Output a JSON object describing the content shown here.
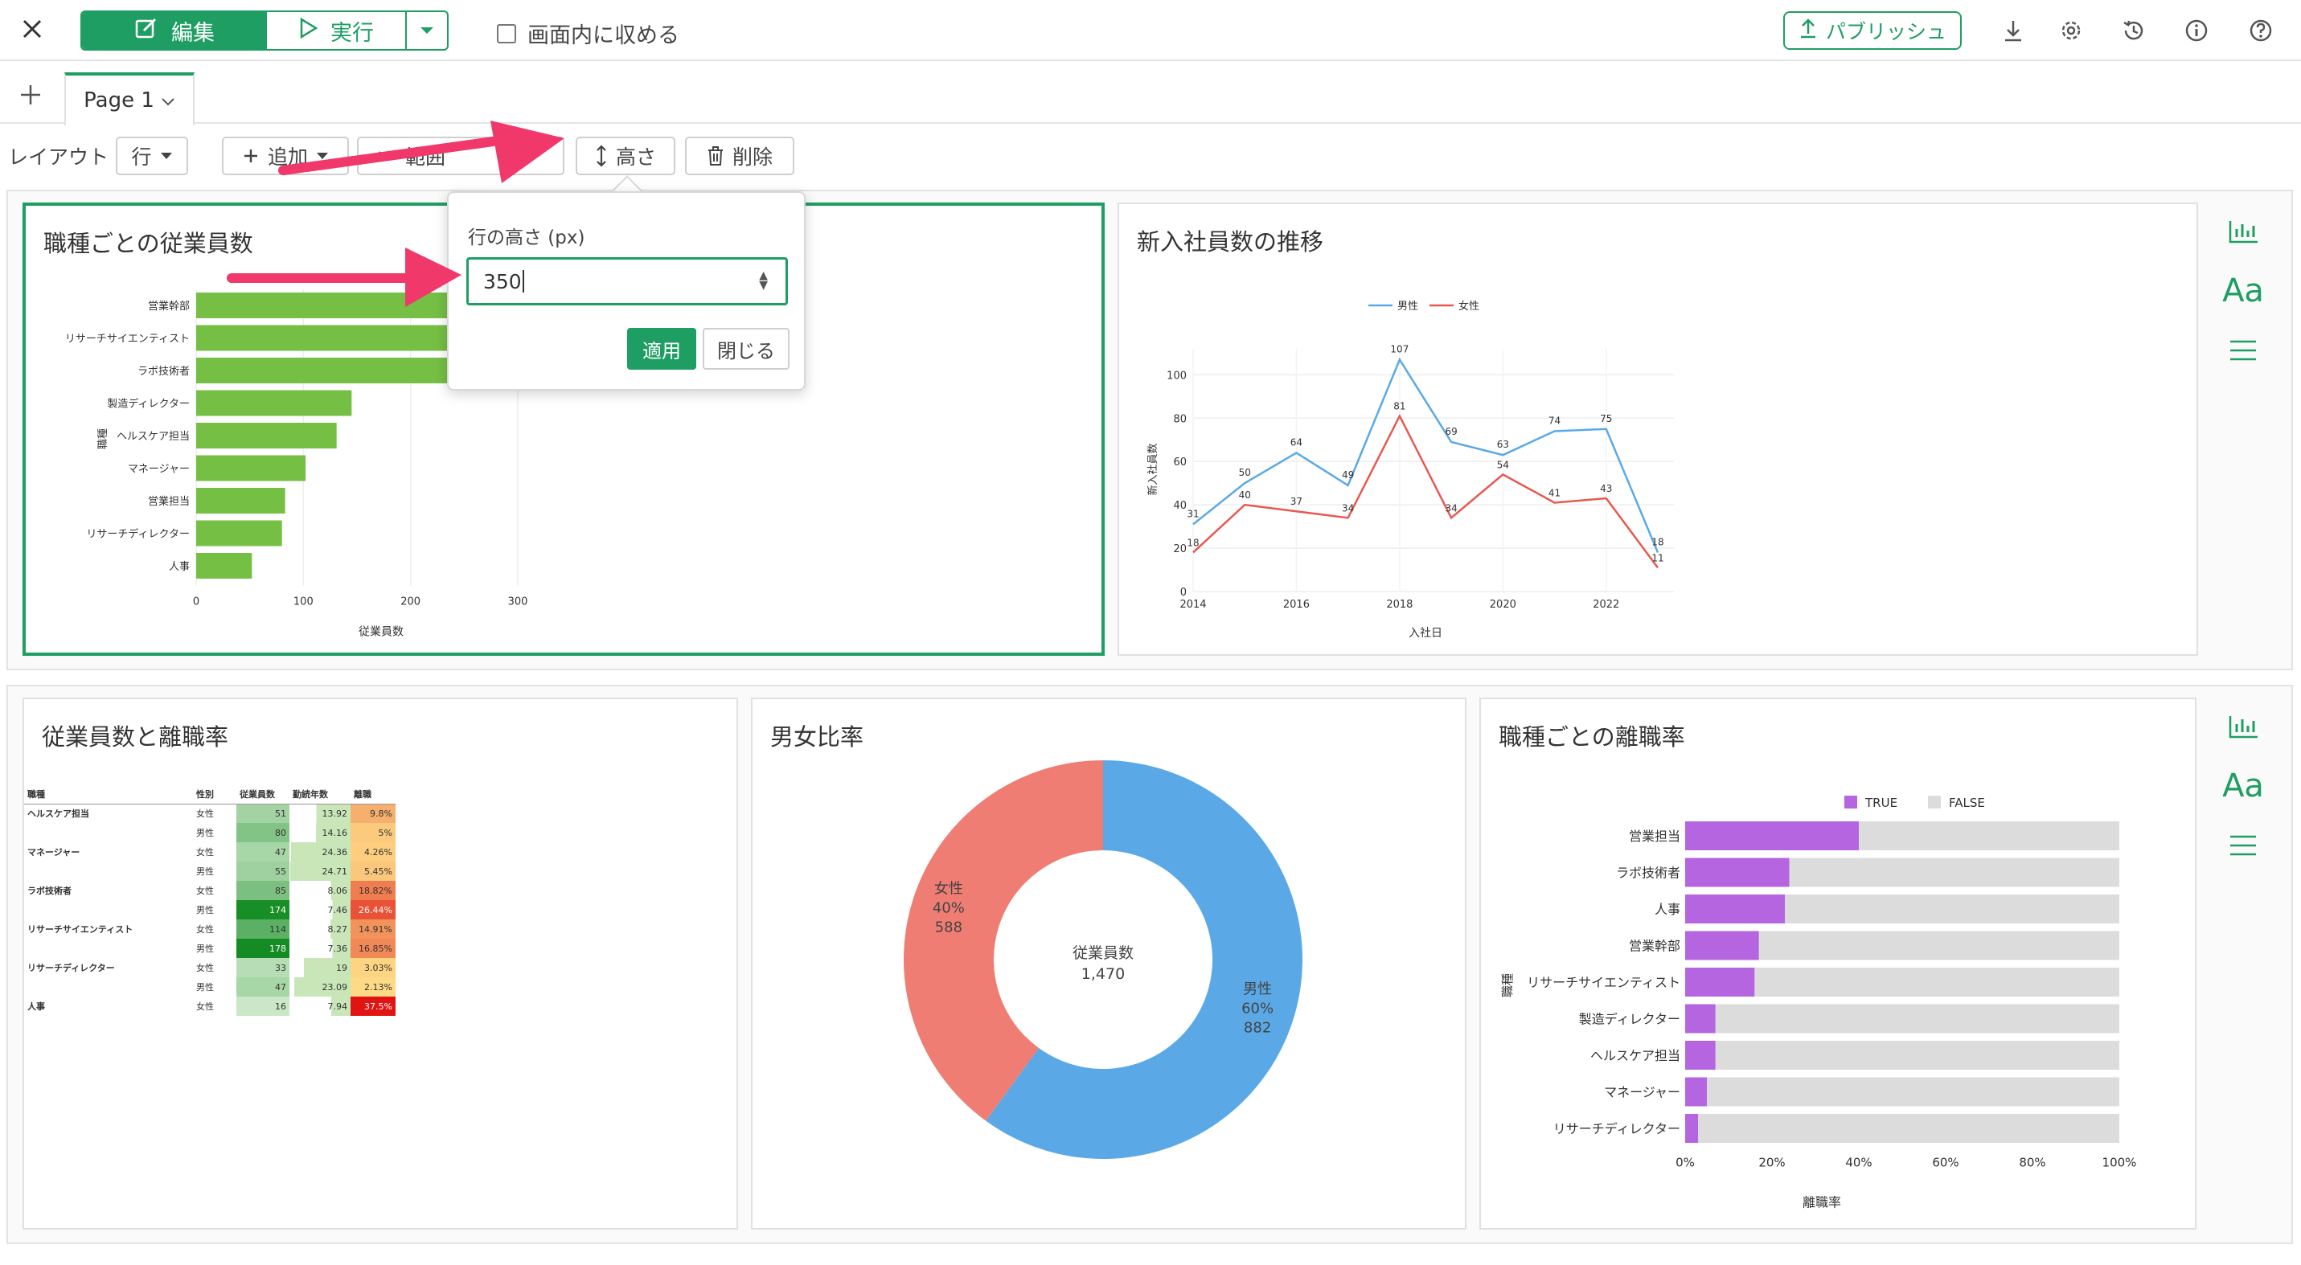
{
  "toolbar": {
    "edit_label": "編集",
    "run_label": "実行",
    "fit_label": "画面内に収める",
    "publish_label": "パブリッシュ"
  },
  "tabs": {
    "page_label": "Page 1"
  },
  "layout_bar": {
    "label": "レイアウト",
    "row_select": "行",
    "add_label": "追加",
    "range_label": "範囲",
    "height_label": "高さ",
    "delete_label": "削除"
  },
  "popup": {
    "label": "行の高さ (px)",
    "value": "350",
    "apply_label": "適用",
    "close_label": "閉じる"
  },
  "cards": {
    "c1_title": "職種ごとの従業員数",
    "c2_title": "新入社員数の推移",
    "c3_title": "従業員数と離職率",
    "c4_title": "男女比率",
    "c5_title": "職種ごとの離職率"
  },
  "icons": {
    "close": "close-icon",
    "edit": "edit-icon",
    "play": "play-icon",
    "publish": "upload-icon",
    "download": "download-icon",
    "settings": "gear-icon",
    "history": "history-icon",
    "info": "info-icon",
    "help": "help-icon",
    "chart": "bar-chart-icon",
    "text": "text-icon",
    "menu": "menu-icon"
  },
  "colors": {
    "accent": "#1e9e63",
    "bar_green": "#74bf44",
    "male": "#5aa9e6",
    "female": "#e8584f",
    "true_purple": "#b565e0",
    "false_gray": "#dcdcdc",
    "arrow": "#f0386b"
  },
  "chart_data": [
    {
      "type": "bar",
      "title": "職種ごとの従業員数",
      "orientation": "horizontal",
      "categories": [
        "営業幹部",
        "リサーチサイエンティスト",
        "ラボ技術者",
        "製造ディレクター",
        "ヘルスケア担当",
        "マネージャー",
        "営業担当",
        "リサーチディレクター",
        "人事"
      ],
      "values": [
        326,
        292,
        259,
        145,
        131,
        102,
        83,
        80,
        52
      ],
      "xlabel": "従業員数",
      "ylabel": "職種",
      "xticks": [
        "0",
        "100",
        "200",
        "300"
      ],
      "xlim": [
        0,
        350
      ]
    },
    {
      "type": "line",
      "title": "新入社員数の推移",
      "x": [
        2014,
        2015,
        2016,
        2017,
        2018,
        2019,
        2020,
        2021,
        2022,
        2023
      ],
      "series": [
        {
          "name": "男性",
          "values": [
            31,
            50,
            64,
            49,
            107,
            69,
            63,
            74,
            75,
            18
          ]
        },
        {
          "name": "女性",
          "values": [
            18,
            40,
            37,
            34,
            81,
            34,
            54,
            41,
            43,
            11
          ]
        }
      ],
      "xlabel": "入社日",
      "ylabel": "新入社員数",
      "xticks": [
        "2014",
        "2016",
        "2018",
        "2020",
        "2022"
      ],
      "yticks": [
        "0",
        "20",
        "40",
        "60",
        "80",
        "100"
      ],
      "ylim": [
        0,
        112
      ]
    },
    {
      "type": "table",
      "title": "従業員数と離職率",
      "columns": [
        "職種",
        "性別",
        "従業員数",
        "勤続年数",
        "離職"
      ],
      "rows": [
        [
          "ヘルスケア担当",
          "女性",
          "51",
          "13.92",
          "9.8%"
        ],
        [
          "",
          "男性",
          "80",
          "14.16",
          "5%"
        ],
        [
          "マネージャー",
          "女性",
          "47",
          "24.36",
          "4.26%"
        ],
        [
          "",
          "男性",
          "55",
          "24.71",
          "5.45%"
        ],
        [
          "ラボ技術者",
          "女性",
          "85",
          "8.06",
          "18.82%"
        ],
        [
          "",
          "男性",
          "174",
          "7.46",
          "26.44%"
        ],
        [
          "リサーチサイエンティスト",
          "女性",
          "114",
          "8.27",
          "14.91%"
        ],
        [
          "",
          "男性",
          "178",
          "7.36",
          "16.85%"
        ],
        [
          "リサーチディレクター",
          "女性",
          "33",
          "19",
          "3.03%"
        ],
        [
          "",
          "男性",
          "47",
          "23.09",
          "2.13%"
        ],
        [
          "人事",
          "女性",
          "16",
          "7.94",
          "37.5%"
        ]
      ]
    },
    {
      "type": "pie",
      "title": "男女比率",
      "center_label": "従業員数",
      "center_value": "1,470",
      "slices": [
        {
          "name": "男性",
          "percent": "60%",
          "value": 882
        },
        {
          "name": "女性",
          "percent": "40%",
          "value": 588
        }
      ]
    },
    {
      "type": "bar",
      "title": "職種ごとの離職率",
      "orientation": "horizontal",
      "stacked": "percent",
      "categories": [
        "営業担当",
        "ラボ技術者",
        "人事",
        "営業幹部",
        "リサーチサイエンティスト",
        "製造ディレクター",
        "ヘルスケア担当",
        "マネージャー",
        "リサーチディレクター"
      ],
      "series": [
        {
          "name": "TRUE",
          "values": [
            40,
            24,
            23,
            17,
            16,
            7,
            7,
            5,
            3
          ]
        },
        {
          "name": "FALSE",
          "values": [
            60,
            76,
            77,
            83,
            84,
            93,
            93,
            95,
            97
          ]
        }
      ],
      "xlabel": "離職率",
      "ylabel": "職種",
      "xticks": [
        "0%",
        "20%",
        "40%",
        "60%",
        "80%",
        "100%"
      ]
    }
  ]
}
